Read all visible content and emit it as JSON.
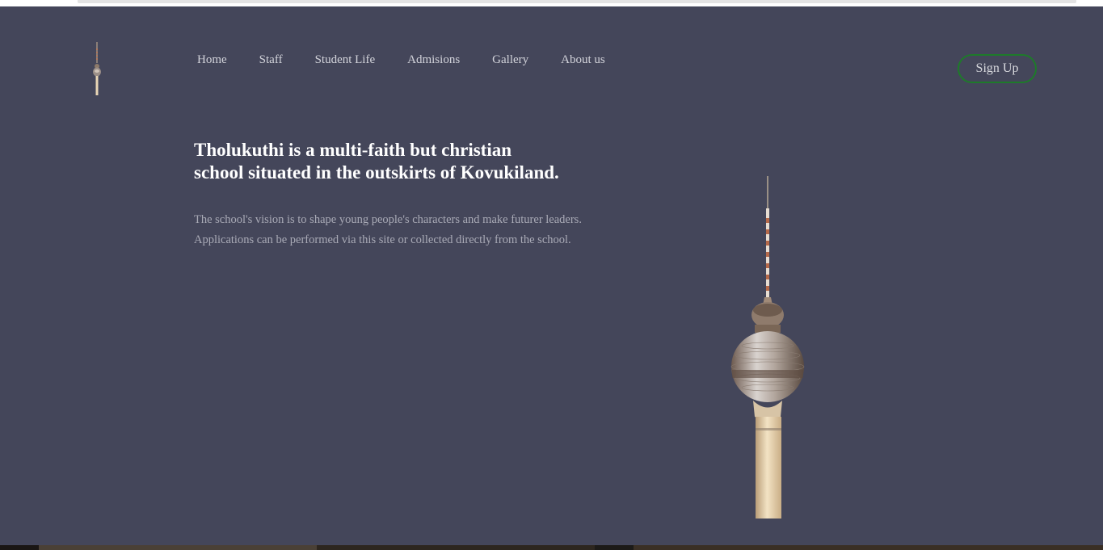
{
  "nav": {
    "items": [
      {
        "label": "Home"
      },
      {
        "label": "Staff"
      },
      {
        "label": "Student Life"
      },
      {
        "label": "Admisions"
      },
      {
        "label": "Gallery"
      },
      {
        "label": "About us"
      }
    ],
    "signup_label": "Sign Up"
  },
  "hero": {
    "headline_line1": "Tholukuthi is a multi-faith but christian",
    "headline_line2": "school situated in the outskirts of Kovukiland.",
    "sub_line1": "The school's vision is to shape young people's characters and make futurer leaders.",
    "sub_line2": "Applications can be performed via this site or collected directly from the school."
  },
  "colors": {
    "background": "#44465a",
    "accent": "#1e7a2a",
    "nav_text": "#d2d3da",
    "muted_text": "#a9aab6"
  },
  "icons": {
    "logo": "tv-tower-icon",
    "hero_image": "tv-tower-image"
  }
}
